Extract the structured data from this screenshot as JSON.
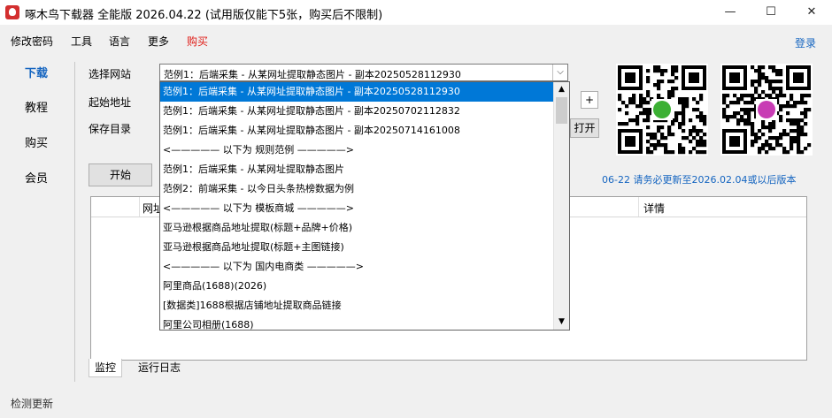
{
  "app": {
    "title": "啄木鸟下载器 全能版 2026.04.22 (试用版仅能下5张，购买后不限制)",
    "window_controls": [
      "—",
      "☐",
      "✕"
    ]
  },
  "menu": {
    "items": [
      "修改密码",
      "工具",
      "语言",
      "更多"
    ],
    "buy": "购买",
    "login": "登录"
  },
  "nav": {
    "items": [
      "下载",
      "教程",
      "购买",
      "会员"
    ]
  },
  "form": {
    "site_label": "选择网站",
    "start_url_label": "起始地址",
    "save_dir_label": "保存目录",
    "site_selected": "范例1：后端采集 - 从某网址提取静态图片 - 副本20250528112930",
    "plus_label": "+",
    "open_label": "打开",
    "start_label": "开始"
  },
  "dropdown": {
    "items": [
      "范例1：后端采集 - 从某网址提取静态图片 - 副本20250528112930",
      "范例1：后端采集 - 从某网址提取静态图片 - 副本20250702112832",
      "范例1：后端采集 - 从某网址提取静态图片 - 副本20250714161008",
      "<————— 以下为 规则范例 —————>",
      "范例1：后端采集 - 从某网址提取静态图片",
      "范例2：前端采集 - 以今日头条热榜数据为例",
      "<————— 以下为 模板商城 —————>",
      "亚马逊根据商品地址提取(标题+品牌+价格)",
      "亚马逊根据商品地址提取(标题+主图链接)",
      "<————— 以下为 国内电商类 —————>",
      "阿里商品(1688)(2026)",
      "[数据类]1688根据店铺地址提取商品链接",
      "阿里公司相册(1688)"
    ]
  },
  "notice": "06-22 请务必更新至2026.02.04或以后版本",
  "table": {
    "columns": [
      "网址",
      "详情"
    ]
  },
  "tabs": [
    "监控",
    "运行日志"
  ],
  "status": "检测更新"
}
